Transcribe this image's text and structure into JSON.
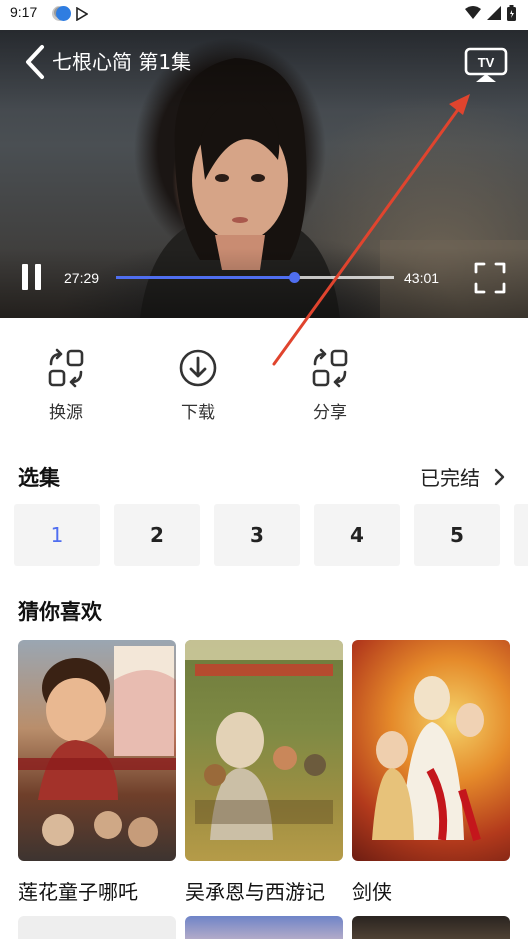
{
  "status_bar": {
    "time": "9:17"
  },
  "player": {
    "title": "七根心简 第1集",
    "current_time": "27:29",
    "duration": "43:01",
    "progress": 0.64,
    "tv_label": "TV"
  },
  "actions": [
    {
      "label": "换源",
      "icon": "switch-source-icon"
    },
    {
      "label": "下载",
      "icon": "download-icon"
    },
    {
      "label": "分享",
      "icon": "share-icon"
    }
  ],
  "episodes": {
    "title": "选集",
    "status": "已完结",
    "items": [
      "1",
      "2",
      "3",
      "4",
      "5"
    ],
    "selected": "1"
  },
  "recommendations": {
    "title": "猜你喜欢",
    "items": [
      {
        "title": "莲花童子哪吒"
      },
      {
        "title": "吴承恩与西游记"
      },
      {
        "title": "剑侠"
      }
    ]
  },
  "colors": {
    "accent": "#4f6ef0",
    "annotation": "#e0442e"
  }
}
